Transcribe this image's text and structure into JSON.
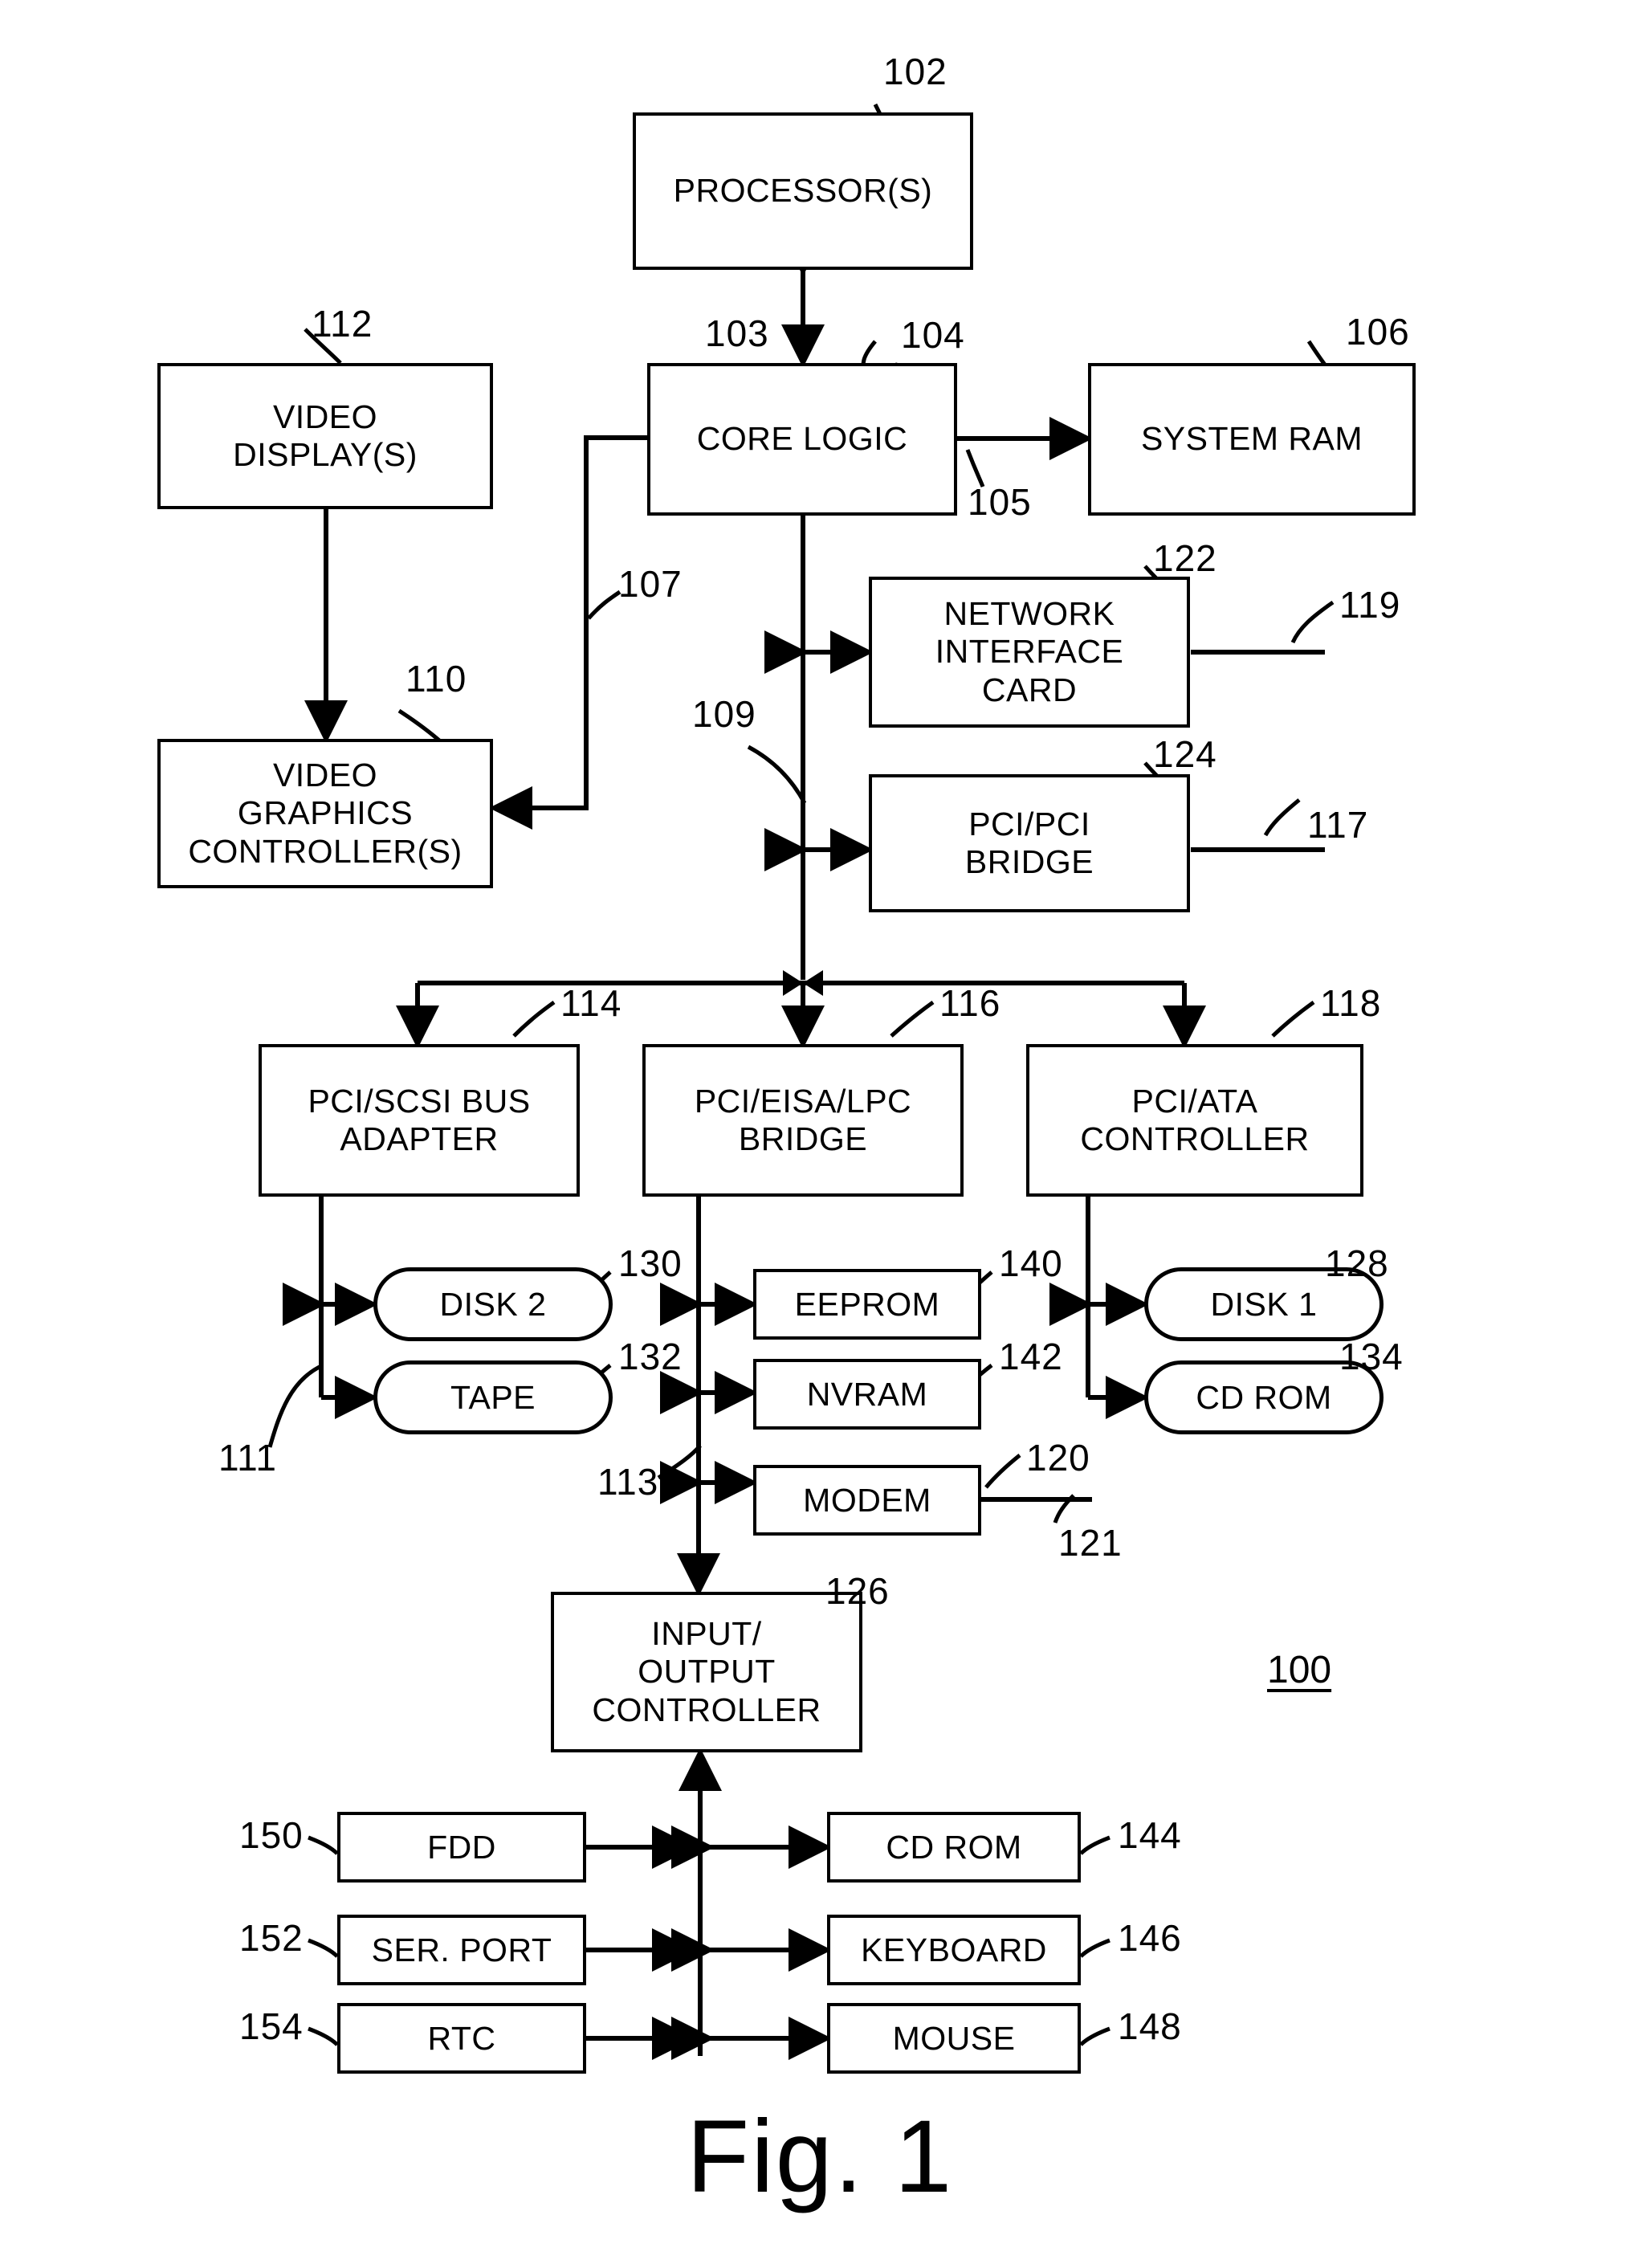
{
  "figure": {
    "caption": "Fig. 1",
    "system_reference": "100"
  },
  "blocks": {
    "processor": {
      "label": "PROCESSOR(S)",
      "ref": "102"
    },
    "core_logic": {
      "label": "CORE LOGIC",
      "ref": "104"
    },
    "system_ram": {
      "label": "SYSTEM RAM",
      "ref": "106"
    },
    "video_display": {
      "label": "VIDEO\nDISPLAY(S)",
      "ref": "112"
    },
    "video_graphics": {
      "label": "VIDEO\nGRAPHICS\nCONTROLLER(S)",
      "ref": "110"
    },
    "nic": {
      "label": "NETWORK\nINTERFACE\nCARD",
      "ref": "122"
    },
    "pci_pci_bridge": {
      "label": "PCI/PCI\nBRIDGE",
      "ref": "124"
    },
    "pci_scsi_adapter": {
      "label": "PCI/SCSI BUS\nADAPTER",
      "ref": "114"
    },
    "pci_eisa_bridge": {
      "label": "PCI/EISA/LPC\nBRIDGE",
      "ref": "116"
    },
    "pci_ata_ctrl": {
      "label": "PCI/ATA\nCONTROLLER",
      "ref": "118"
    },
    "io_controller": {
      "label": "INPUT/\nOUTPUT\nCONTROLLER",
      "ref": "126"
    },
    "disk2": {
      "label": "DISK 2",
      "ref": "130"
    },
    "tape": {
      "label": "TAPE",
      "ref": "132"
    },
    "eeprom": {
      "label": "EEPROM",
      "ref": "140"
    },
    "nvram": {
      "label": "NVRAM",
      "ref": "142"
    },
    "modem": {
      "label": "MODEM",
      "ref": "120"
    },
    "disk1": {
      "label": "DISK 1",
      "ref": "128"
    },
    "cdrom_ata": {
      "label": "CD ROM",
      "ref": "134"
    },
    "fdd": {
      "label": "FDD",
      "ref": "150"
    },
    "ser_port": {
      "label": "SER. PORT",
      "ref": "152"
    },
    "rtc": {
      "label": "RTC",
      "ref": "154"
    },
    "cdrom_io": {
      "label": "CD ROM",
      "ref": "144"
    },
    "keyboard": {
      "label": "KEYBOARD",
      "ref": "146"
    },
    "mouse": {
      "label": "MOUSE",
      "ref": "148"
    }
  },
  "bus_refs": {
    "host_bus": "103",
    "memory_bus": "105",
    "agp_bus": "107",
    "pci_bus": "109",
    "scsi_bus": "111",
    "ata_bus": "113",
    "nic_link": "119",
    "pci_bridge_link": "117",
    "modem_line": "121"
  }
}
